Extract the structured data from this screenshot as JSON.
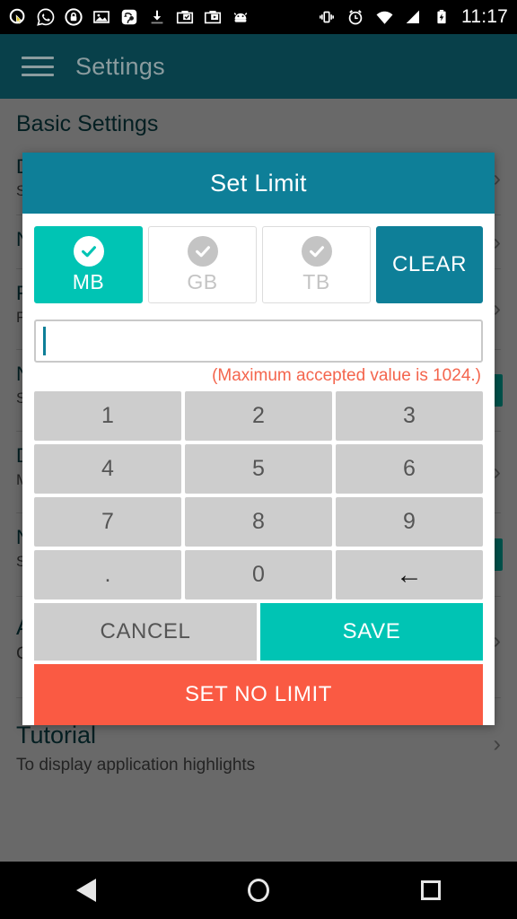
{
  "status_bar": {
    "clock": "11:17",
    "left_icons": [
      "search-cursor-icon",
      "whatsapp-icon",
      "lock-icon",
      "image-icon",
      "contact-sync-icon",
      "download-icon",
      "briefcase-check-icon",
      "briefcase-play-icon",
      "android-head-icon"
    ],
    "right_icons": [
      "vibrate-icon",
      "alarm-icon",
      "wifi-icon",
      "signal-icon",
      "battery-charging-icon"
    ]
  },
  "app_bar": {
    "menu_icon": "hamburger-icon",
    "title": "Settings"
  },
  "page": {
    "section_title": "Basic Settings",
    "items": [
      {
        "title": "D",
        "subtitle": "S"
      },
      {
        "title": "N",
        "subtitle": ""
      },
      {
        "title": "F",
        "subtitle": "F\nS"
      },
      {
        "title": "N",
        "subtitle": "S\nM"
      },
      {
        "title": "D",
        "subtitle": "M"
      },
      {
        "title": "N",
        "subtitle": "S\nc"
      },
      {
        "title": "Apps",
        "subtitle": "Click to Add/Remove from exclusion list of optimization"
      },
      {
        "title": "Tutorial",
        "subtitle": "To display application highlights"
      }
    ],
    "chevron_icon": "chevron-right-icon"
  },
  "dialog": {
    "title": "Set Limit",
    "units": [
      {
        "label": "MB",
        "selected": true,
        "icon": "check-circle-icon"
      },
      {
        "label": "GB",
        "selected": false,
        "icon": "check-circle-icon"
      },
      {
        "label": "TB",
        "selected": false,
        "icon": "check-circle-icon"
      }
    ],
    "clear_label": "CLEAR",
    "input": {
      "value": "",
      "placeholder": ""
    },
    "hint": "(Maximum accepted value is 1024.)",
    "keypad": [
      {
        "label": "1",
        "name": "key-1"
      },
      {
        "label": "2",
        "name": "key-2"
      },
      {
        "label": "3",
        "name": "key-3"
      },
      {
        "label": "4",
        "name": "key-4"
      },
      {
        "label": "5",
        "name": "key-5"
      },
      {
        "label": "6",
        "name": "key-6"
      },
      {
        "label": "7",
        "name": "key-7"
      },
      {
        "label": "8",
        "name": "key-8"
      },
      {
        "label": "9",
        "name": "key-9"
      },
      {
        "label": ".",
        "name": "key-decimal"
      },
      {
        "label": "0",
        "name": "key-0"
      },
      {
        "label": "←",
        "name": "key-backspace"
      }
    ],
    "cancel_label": "CANCEL",
    "save_label": "SAVE",
    "no_limit_label": "SET NO LIMIT"
  },
  "nav_bar": {
    "back": "back-icon",
    "home": "home-icon",
    "recents": "recents-icon"
  },
  "colors": {
    "app_bar": "#08404a",
    "dialog_header": "#0e7f98",
    "accent_teal": "#00c4b4",
    "danger_red": "#fa5a43",
    "hint_red": "#f4654d",
    "key_grey": "#cdcdcd",
    "status_black": "#000000"
  }
}
